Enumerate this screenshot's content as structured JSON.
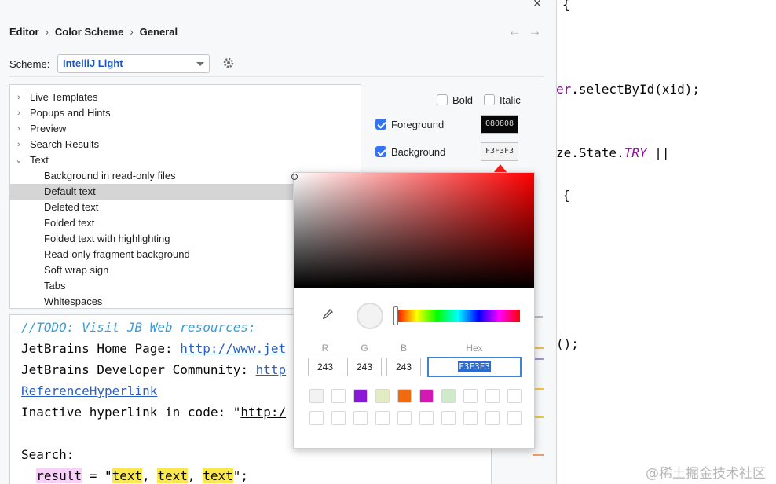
{
  "breadcrumb": {
    "items": [
      "Editor",
      "Color Scheme",
      "General"
    ],
    "sep": "›"
  },
  "nav": {
    "back": "←",
    "forward": "→"
  },
  "close_glyph": "×",
  "scheme": {
    "label": "Scheme:",
    "value": "IntelliJ Light"
  },
  "tree": {
    "items": [
      {
        "label": "Live Templates",
        "expander": "›",
        "level": 0
      },
      {
        "label": "Popups and Hints",
        "expander": "›",
        "level": 0
      },
      {
        "label": "Preview",
        "expander": "›",
        "level": 0
      },
      {
        "label": "Search Results",
        "expander": "›",
        "level": 0
      },
      {
        "label": "Text",
        "expander": "⌄",
        "level": 0
      },
      {
        "label": "Background in read-only files",
        "level": 1
      },
      {
        "label": "Default text",
        "level": 1,
        "selected": true
      },
      {
        "label": "Deleted text",
        "level": 1
      },
      {
        "label": "Folded text",
        "level": 1
      },
      {
        "label": "Folded text with highlighting",
        "level": 1
      },
      {
        "label": "Read-only fragment background",
        "level": 1
      },
      {
        "label": "Soft wrap sign",
        "level": 1
      },
      {
        "label": "Tabs",
        "level": 1
      },
      {
        "label": "Whitespaces",
        "level": 1
      }
    ]
  },
  "attributes": {
    "bold": {
      "label": "Bold",
      "checked": false
    },
    "italic": {
      "label": "Italic",
      "checked": false
    },
    "foreground": {
      "label": "Foreground",
      "checked": true,
      "hex": "080808",
      "color": "#080808"
    },
    "background": {
      "label": "Background",
      "checked": true,
      "hex": "F3F3F3",
      "color": "#F3F3F3"
    }
  },
  "preview": {
    "todo": "//TODO: Visit JB Web resources:",
    "home_prefix": "JetBrains Home Page: ",
    "home_link": "http://www.jet",
    "community_prefix": "JetBrains Developer Community: ",
    "community_link": "http",
    "ref_link": "ReferenceHyperlink",
    "inactive_prefix": "Inactive hyperlink in code: \"",
    "inactive_link": "http:/",
    "search": "Search:",
    "result_var": "result",
    "result_eq": " = \"",
    "text1": "text",
    "comma1": ", ",
    "text2": "text",
    "comma2": ", ",
    "text3": "text",
    "result_end": "\";"
  },
  "code_editor": {
    "line1": "{",
    "line2_purple": "er",
    "line2_rest": ".selectById(xid);",
    "line3_a": "ze.State.",
    "line3_b": "TRY",
    "line3_c": " ||",
    "line4": "{",
    "line5": "();",
    "line6": ";"
  },
  "picker": {
    "r_label": "R",
    "g_label": "G",
    "b_label": "B",
    "hex_label": "Hex",
    "r": "243",
    "g": "243",
    "b": "243",
    "hex": "F3F3F3",
    "recent_colors": [
      "#f2f2f2",
      "#ffffff",
      "#8a18d8",
      "#e3ecc0",
      "#f06a0f",
      "#d318b5",
      "#cfeac9",
      "#ffffff",
      "#ffffff",
      "#ffffff",
      "#ffffff",
      "#ffffff",
      "#ffffff",
      "#ffffff",
      "#ffffff",
      "#ffffff",
      "#ffffff",
      "#ffffff",
      "#ffffff",
      "#ffffff"
    ]
  },
  "watermark": "@稀土掘金技术社区"
}
